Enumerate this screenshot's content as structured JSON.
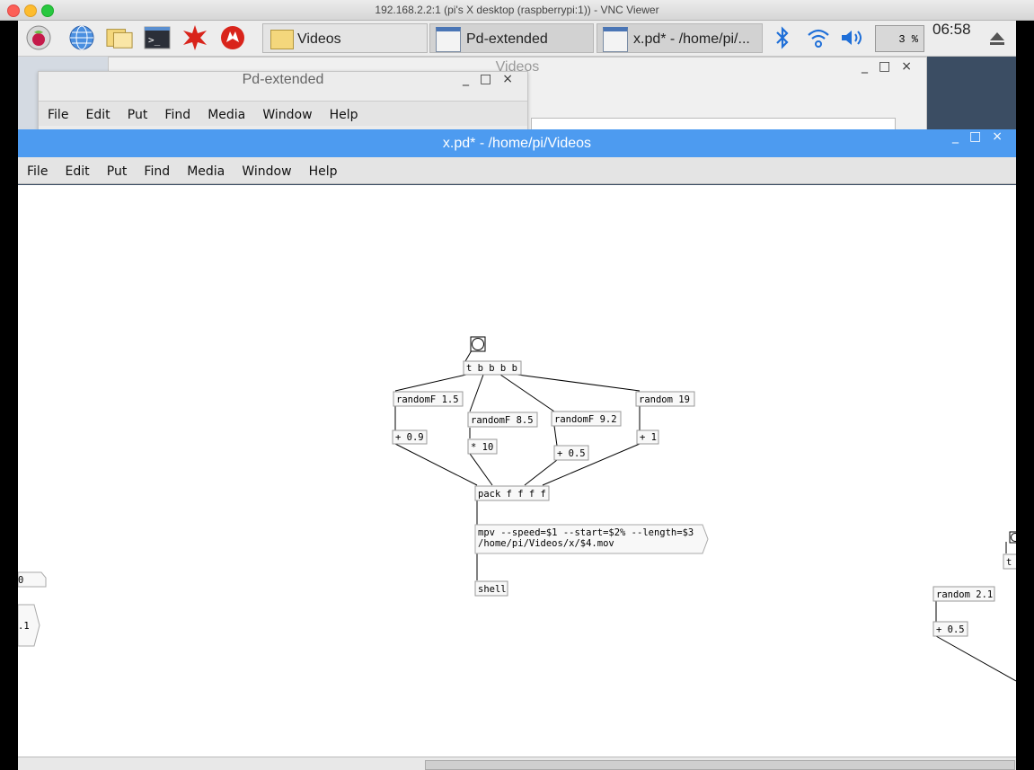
{
  "mac_window": {
    "title": "192.168.2.2:1 (pi's X desktop (raspberrypi:1)) - VNC Viewer"
  },
  "panel": {
    "launchers": [
      "raspberry-menu-icon",
      "web-browser-icon",
      "file-manager-icon",
      "terminal-icon",
      "mathematica-icon",
      "wolfram-icon"
    ],
    "tasks": [
      {
        "label": "Videos"
      },
      {
        "label": "Pd-extended"
      },
      {
        "label": "x.pd* - /home/pi/..."
      }
    ],
    "cpu": "3 %",
    "clock": "06:58"
  },
  "videos_window": {
    "title": "Videos"
  },
  "pd_window": {
    "title": "Pd-extended",
    "menu": [
      "File",
      "Edit",
      "Put",
      "Find",
      "Media",
      "Window",
      "Help"
    ]
  },
  "patch_window": {
    "title": "x.pd* - /home/pi/Videos",
    "menu": [
      "File",
      "Edit",
      "Put",
      "Find",
      "Media",
      "Window",
      "Help"
    ]
  },
  "patch": {
    "objects": {
      "trigger": "t b b b b",
      "randomF1": "randomF 1.5",
      "randomF2": "randomF 8.5",
      "randomF3": "randomF 9.2",
      "random19": "random 19",
      "add09": "+ 0.9",
      "mul10": "* 10",
      "add05": "+ 0.5",
      "add1": "+ 1",
      "pack": "pack f f f f",
      "msg_line1": "mpv --speed=$1 --start=$2% --length=$3",
      "msg_line2": "/home/pi/Videos/x/$4.mov",
      "shell": "shell",
      "right_random": "random 2.1",
      "right_add": "+ 0.5",
      "right_t": "t",
      "left_frag1": "0",
      "left_frag2": ".1"
    }
  }
}
